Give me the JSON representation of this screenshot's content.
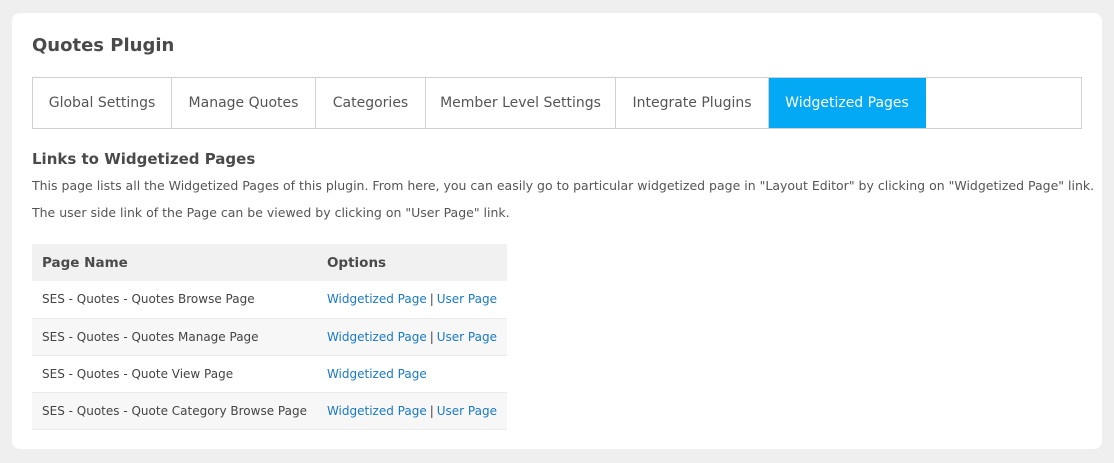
{
  "header": {
    "title": "Quotes Plugin"
  },
  "tabs": [
    {
      "label": "Global Settings"
    },
    {
      "label": "Manage Quotes"
    },
    {
      "label": "Categories"
    },
    {
      "label": "Member Level Settings"
    },
    {
      "label": "Integrate Plugins"
    },
    {
      "label": "Widgetized Pages"
    }
  ],
  "active_tab": "Widgetized Pages",
  "section": {
    "title": "Links to Widgetized Pages",
    "description_1": "This page lists all the Widgetized Pages of this plugin. From here, you can easily go to particular widgetized page in \"Layout Editor\" by clicking on \"Widgetized Page\" link.",
    "description_2": "The user side link of the Page can be viewed by clicking on \"User Page\" link."
  },
  "table": {
    "columns": [
      "Page Name",
      "Options"
    ],
    "rows": [
      {
        "name": "SES - Quotes - Quotes Browse Page",
        "widgetized_label": "Widgetized Page",
        "separator": "|",
        "user_label": "User Page"
      },
      {
        "name": "SES - Quotes - Quotes Manage Page",
        "widgetized_label": "Widgetized Page",
        "separator": "|",
        "user_label": "User Page"
      },
      {
        "name": "SES - Quotes - Quote View Page",
        "widgetized_label": "Widgetized Page"
      },
      {
        "name": "SES - Quotes - Quote Category Browse Page",
        "widgetized_label": "Widgetized Page",
        "separator": "|",
        "user_label": "User Page"
      }
    ]
  },
  "colors": {
    "accent": "#03a9f4",
    "link": "#1a79c4",
    "background": "#efefef",
    "card": "#ffffff"
  }
}
